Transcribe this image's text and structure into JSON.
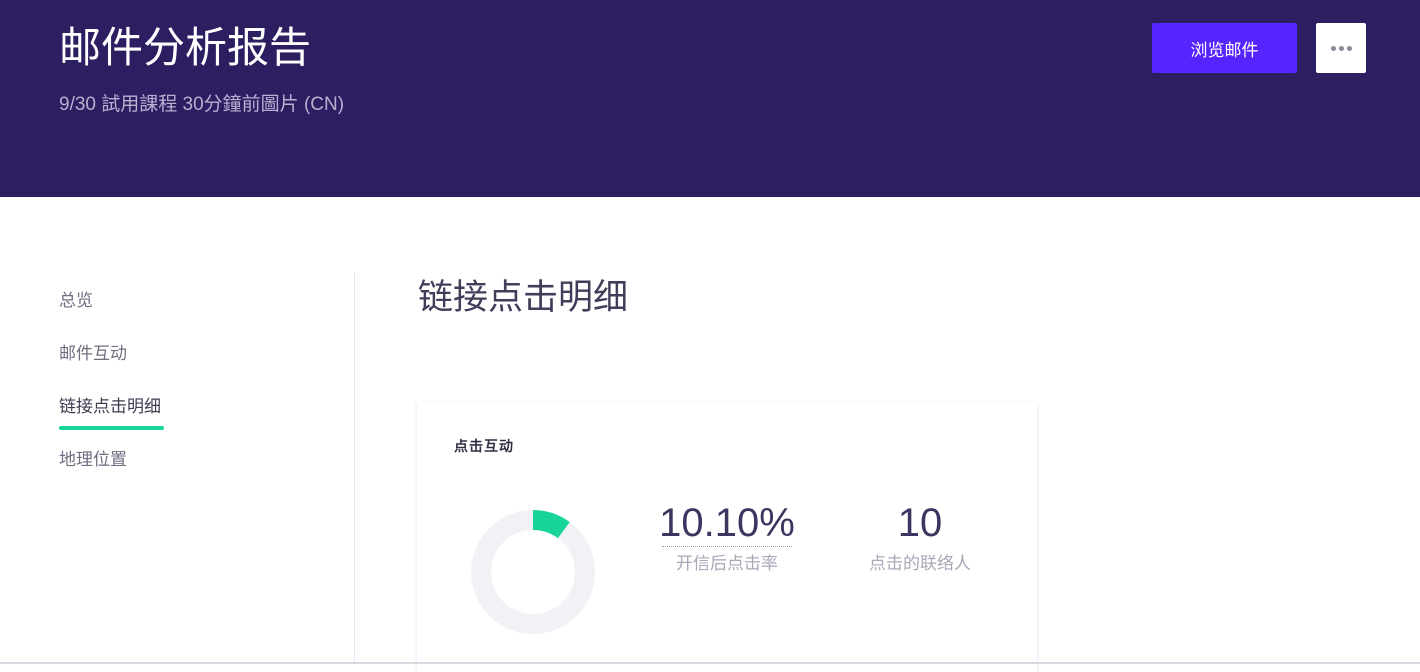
{
  "header": {
    "title": "邮件分析报告",
    "subtitle": "9/30 試用課程 30分鐘前圖片 (CN)",
    "browse_button_label": "浏览邮件",
    "more_icon": "more-dots-icon"
  },
  "sidebar": {
    "items": [
      {
        "label": "总览",
        "active": false
      },
      {
        "label": "邮件互动",
        "active": false
      },
      {
        "label": "链接点击明细",
        "active": true
      },
      {
        "label": "地理位置",
        "active": false
      }
    ]
  },
  "main": {
    "section_title": "链接点击明细",
    "card": {
      "title": "点击互动",
      "click_rate_value": "10.10%",
      "click_rate_label": "开信后点击率",
      "clicked_contacts_value": "10",
      "clicked_contacts_label": "点击的联络人",
      "donut_fraction": 0.101
    }
  },
  "colors": {
    "header_bg": "#2d1e62",
    "primary_button": "#5624ff",
    "accent_green": "#19d49a",
    "donut_track": "#f1f1f6",
    "metric_text": "#3b3660"
  }
}
